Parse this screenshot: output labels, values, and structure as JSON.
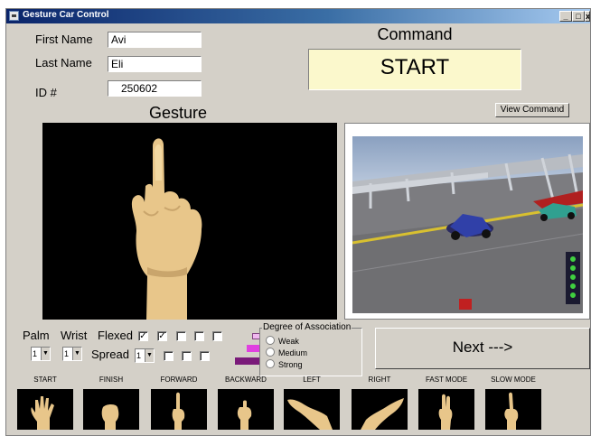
{
  "window": {
    "title": "Gesture Car Control",
    "controls": {
      "minimize": "_",
      "restore": "□",
      "close": "x"
    }
  },
  "form": {
    "first_name_label": "First Name",
    "first_name_value": "Avi",
    "last_name_label": "Last Name",
    "last_name_value": "Eli",
    "id_label": "ID #",
    "id_value": "250602"
  },
  "command": {
    "heading": "Command",
    "value": "START",
    "view_button": "View Command"
  },
  "gesture": {
    "heading": "Gesture"
  },
  "controls": {
    "palm_label": "Palm",
    "wrist_label": "Wrist",
    "flexed_label": "Flexed",
    "spread_label": "Spread",
    "palm_value": "1",
    "wrist_value": "1",
    "spread_value": "1",
    "flexed_checks": [
      true,
      true,
      false,
      false,
      false
    ],
    "spread_checks": [
      false,
      false,
      false
    ]
  },
  "association": {
    "title": "Degree of Association",
    "options": [
      "Weak",
      "Medium",
      "Strong"
    ]
  },
  "next_button": "Next --->",
  "colors": {
    "accent_bar_light": "#e060e0",
    "accent_bar_mid": "#c030c0",
    "accent_bar_dark": "#7a1a7a",
    "command_bg": "#fbf8cc"
  },
  "command_thumbnails": [
    "START",
    "FINISH",
    "FORWARD",
    "BACKWARD",
    "LEFT",
    "RIGHT",
    "FAST MODE",
    "SLOW MODE"
  ]
}
